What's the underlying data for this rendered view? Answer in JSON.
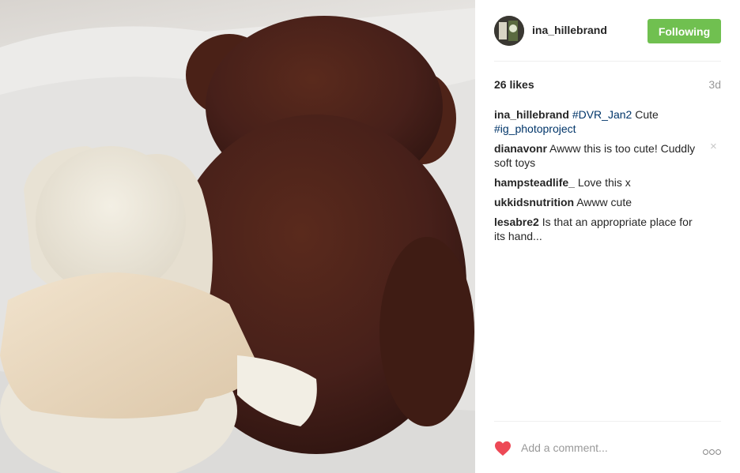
{
  "post": {
    "username": "ina_hillebrand",
    "follow_label": "Following",
    "likes": "26 likes",
    "age": "3d",
    "caption": {
      "user": "ina_hillebrand",
      "tag1": "#DVR_Jan2",
      "text": " Cute",
      "tag2": "#ig_photoproject"
    },
    "comments": [
      {
        "user": "dianavonr",
        "text": "Awww this is too cute! Cuddly soft toys"
      },
      {
        "user": "hampsteadlife_",
        "text": "Love this x"
      },
      {
        "user": "ukkidsnutrition",
        "text": "Awww cute"
      },
      {
        "user": "lesabre2",
        "text": "Is that an appropriate place for its hand..."
      }
    ],
    "comment_placeholder": "Add a comment...",
    "delete_glyph": "×"
  },
  "icons": {
    "like": "heart-icon",
    "options": "more-options-icon",
    "delete": "close-icon",
    "avatar": "avatar"
  },
  "colors": {
    "follow_button": "#70c050",
    "hashtag": "#003569",
    "heart": "#ed4956",
    "muted": "#999999"
  }
}
